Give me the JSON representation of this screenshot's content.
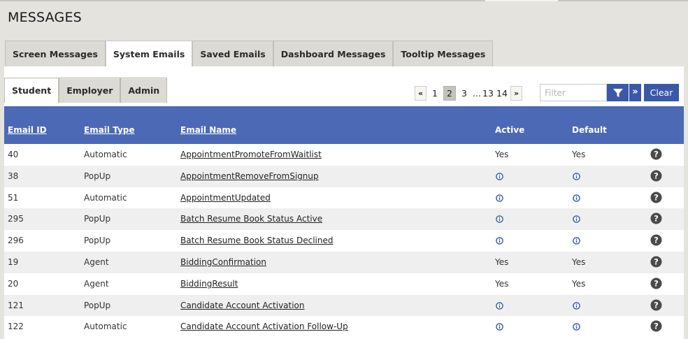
{
  "page": {
    "title": "MESSAGES"
  },
  "main_tabs": [
    {
      "label": "Screen Messages",
      "active": false
    },
    {
      "label": "System Emails",
      "active": true
    },
    {
      "label": "Saved Emails",
      "active": false
    },
    {
      "label": "Dashboard Messages",
      "active": false
    },
    {
      "label": "Tooltip Messages",
      "active": false
    }
  ],
  "sub_tabs": [
    {
      "label": "Student",
      "active": true
    },
    {
      "label": "Employer",
      "active": false
    },
    {
      "label": "Admin",
      "active": false
    }
  ],
  "pagination": {
    "first": "«",
    "last": "»",
    "pages": [
      "1",
      "2",
      "3",
      "...",
      "13",
      "14"
    ],
    "current": "2"
  },
  "filter": {
    "placeholder": "Filter",
    "value": "",
    "expand_label": "»",
    "clear_label": "Clear"
  },
  "colors": {
    "accent": "#4c69b6",
    "button": "#3a58a7",
    "alt_row": "#efefef"
  },
  "table": {
    "columns": [
      "Email ID",
      "Email Type",
      "Email Name",
      "Active",
      "Default"
    ],
    "rows": [
      {
        "id": "40",
        "type": "Automatic",
        "name": "AppointmentPromoteFromWaitlist",
        "active": "Yes",
        "default": "Yes"
      },
      {
        "id": "38",
        "type": "PopUp",
        "name": "AppointmentRemoveFromSignup",
        "active": "info-icon",
        "default": "info-icon"
      },
      {
        "id": "51",
        "type": "Automatic",
        "name": "AppointmentUpdated",
        "active": "info-icon",
        "default": "info-icon"
      },
      {
        "id": "295",
        "type": "PopUp",
        "name": "Batch Resume Book Status Active",
        "active": "info-icon",
        "default": "info-icon"
      },
      {
        "id": "296",
        "type": "PopUp",
        "name": "Batch Resume Book Status Declined",
        "active": "info-icon",
        "default": "info-icon"
      },
      {
        "id": "19",
        "type": "Agent",
        "name": "BiddingConfirmation",
        "active": "Yes",
        "default": "Yes"
      },
      {
        "id": "20",
        "type": "Agent",
        "name": "BiddingResult",
        "active": "Yes",
        "default": "Yes"
      },
      {
        "id": "121",
        "type": "PopUp",
        "name": "Candidate Account Activation",
        "active": "info-icon",
        "default": "info-icon"
      },
      {
        "id": "122",
        "type": "Automatic",
        "name": "Candidate Account Activation Follow-Up",
        "active": "info-icon",
        "default": "info-icon"
      }
    ]
  }
}
